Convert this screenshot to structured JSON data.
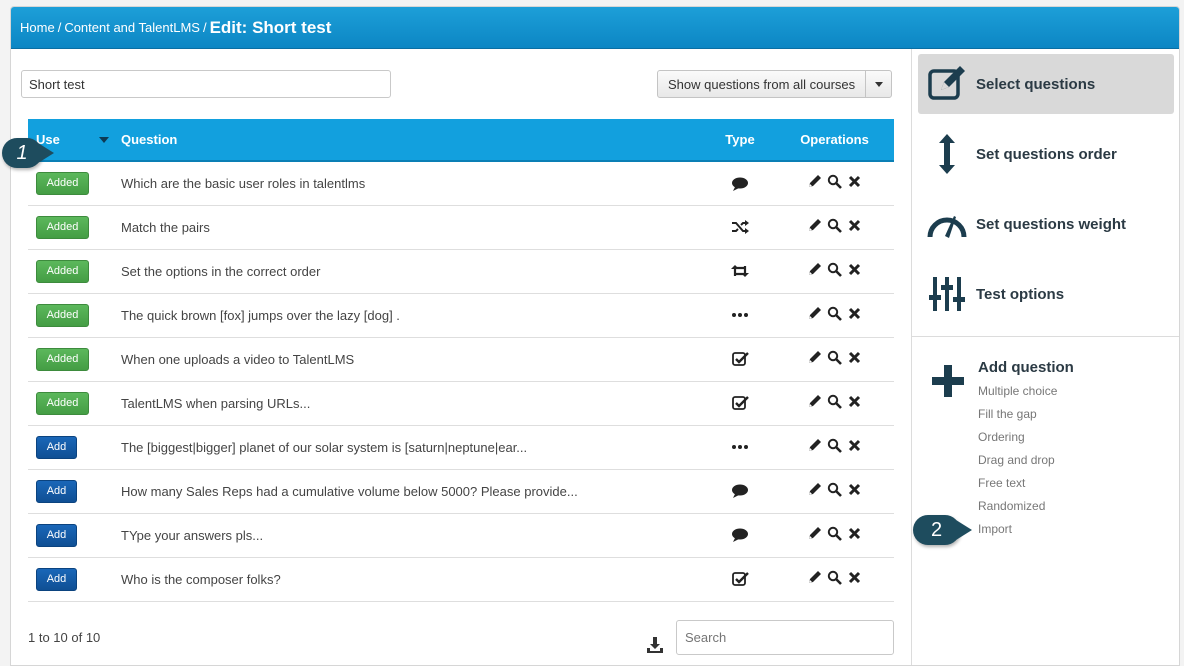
{
  "breadcrumb": {
    "home": "Home",
    "section": "Content and TalentLMS",
    "current": "Edit: Short test"
  },
  "test_name": "Short test",
  "filter_label": "Show questions from all courses",
  "table": {
    "headers": {
      "use": "Use",
      "question": "Question",
      "type": "Type",
      "operations": "Operations"
    },
    "rows": [
      {
        "status": "Added",
        "question": "Which are the basic user roles in talentlms",
        "type_icon": "comment-icon"
      },
      {
        "status": "Added",
        "question": "Match the pairs",
        "type_icon": "shuffle-icon"
      },
      {
        "status": "Added",
        "question": "Set the options in the correct order",
        "type_icon": "retweet-icon"
      },
      {
        "status": "Added",
        "question": "The quick brown [fox] jumps over the lazy [dog] .",
        "type_icon": "ellipsis-icon"
      },
      {
        "status": "Added",
        "question": "When one uploads a video to TalentLMS",
        "type_icon": "checkbox-icon"
      },
      {
        "status": "Added",
        "question": "TalentLMS when parsing URLs...",
        "type_icon": "checkbox-icon"
      },
      {
        "status": "Add",
        "question": "The [biggest|bigger] planet of our solar system is [saturn|neptune|ear...",
        "type_icon": "ellipsis-icon"
      },
      {
        "status": "Add",
        "question": "How many Sales Reps had a cumulative volume below 5000? Please provide...",
        "type_icon": "comment-icon"
      },
      {
        "status": "Add",
        "question": "TYpe your answers pls...",
        "type_icon": "comment-icon"
      },
      {
        "status": "Add",
        "question": "Who is the composer folks?",
        "type_icon": "checkbox-icon"
      }
    ]
  },
  "pager_text": "1 to 10 of 10",
  "search_placeholder": "Search",
  "sidebar": {
    "items": [
      {
        "label": "Select questions",
        "icon": "edit-icon",
        "active": true
      },
      {
        "label": "Set questions order",
        "icon": "vertical-arrows-icon",
        "active": false
      },
      {
        "label": "Set questions weight",
        "icon": "gauge-icon",
        "active": false
      },
      {
        "label": "Test options",
        "icon": "sliders-icon",
        "active": false
      }
    ],
    "add_question": {
      "title": "Add question",
      "types": [
        "Multiple choice",
        "Fill the gap",
        "Ordering",
        "Drag and drop",
        "Free text",
        "Randomized",
        "Import"
      ]
    }
  },
  "callouts": [
    "1",
    "2"
  ],
  "colors": {
    "header_blue": "#12a0de",
    "added_green": "#5cb85c",
    "add_blue": "#0f4f94",
    "callout": "#1e4c5e"
  }
}
